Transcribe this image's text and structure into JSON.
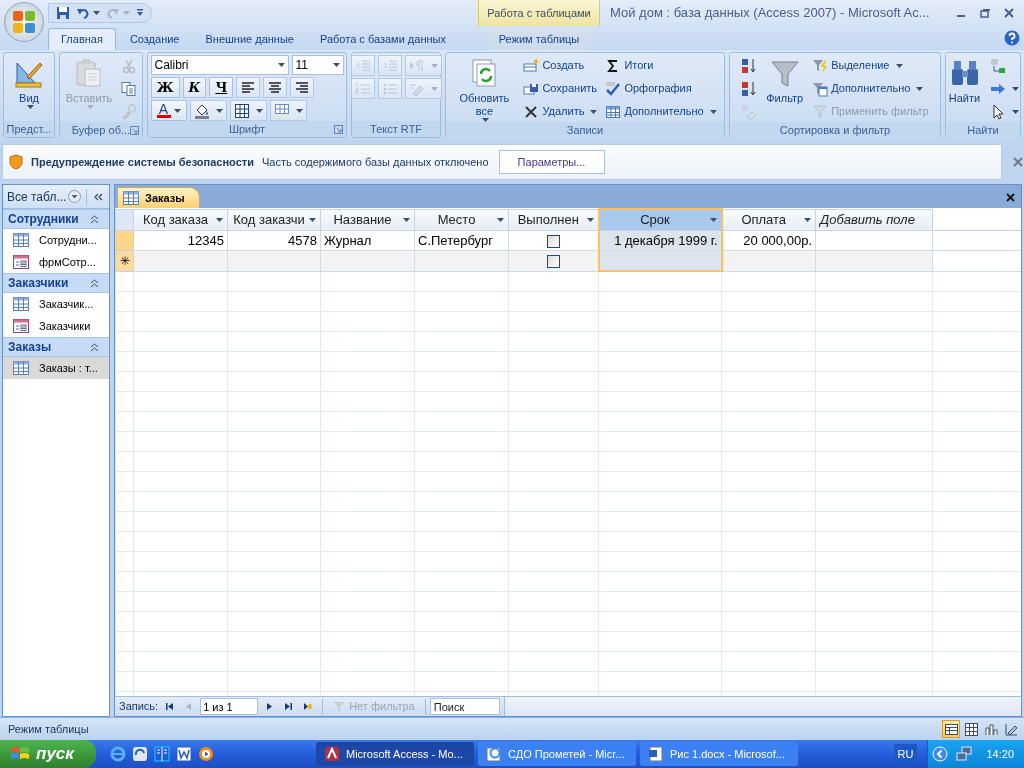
{
  "window": {
    "title": "Мой дом : база данных (Access 2007) - Microsoft Ac...",
    "contextual_tab": "Работа с таблицами"
  },
  "quick_access": [
    {
      "kind": "save",
      "disabled": false
    },
    {
      "kind": "undo",
      "disabled": false,
      "dropdown": true
    },
    {
      "kind": "redo",
      "disabled": true,
      "dropdown": true
    },
    {
      "kind": "customize",
      "disabled": false
    }
  ],
  "ribbon_tabs": [
    {
      "label": "Главная",
      "selected": true,
      "contextual": false
    },
    {
      "label": "Создание",
      "selected": false,
      "contextual": false
    },
    {
      "label": "Внешние данные",
      "selected": false,
      "contextual": false
    },
    {
      "label": "Работа с базами данных",
      "selected": false,
      "contextual": false
    },
    {
      "label": "Режим таблицы",
      "selected": false,
      "contextual": true
    }
  ],
  "ribbon_groups": [
    {
      "title": "Предст...",
      "launcher": false,
      "columns": [
        [
          [
            {
              "kind": "large",
              "label": "Вид",
              "dropdown": true,
              "disabled": false
            }
          ]
        ]
      ]
    },
    {
      "title": "Буфер об...",
      "launcher": true,
      "columns": [
        [
          [
            {
              "kind": "large",
              "label": "Вставить",
              "dropdown": true,
              "disabled": true
            }
          ]
        ],
        [
          [
            {
              "kind": "icon",
              "disabled": true
            }
          ],
          [
            {
              "kind": "icon",
              "disabled": false
            }
          ],
          [
            {
              "kind": "icon",
              "disabled": true
            }
          ]
        ]
      ]
    },
    {
      "title": "Шрифт",
      "launcher": true,
      "columns": [
        [
          [
            {
              "kind": "combo",
              "value": "Calibri",
              "disabled": false
            },
            {
              "kind": "combo",
              "value": "11",
              "disabled": false
            }
          ],
          [
            {
              "kind": "glyph",
              "label": "Ж",
              "disabled": false
            },
            {
              "kind": "glyph",
              "label": "К",
              "disabled": false
            },
            {
              "kind": "glyph",
              "label": "Ч",
              "disabled": false
            },
            {
              "kind": "icon",
              "disabled": false
            },
            {
              "kind": "icon",
              "disabled": false
            },
            {
              "kind": "icon",
              "disabled": false
            }
          ],
          [
            {
              "kind": "glyph",
              "label": "A",
              "dropdown": true,
              "disabled": false
            },
            {
              "kind": "icon",
              "dropdown": true,
              "disabled": false
            },
            {
              "kind": "icon",
              "dropdown": true,
              "disabled": false
            },
            {
              "kind": "icon",
              "dropdown": true,
              "disabled": false
            }
          ]
        ]
      ]
    },
    {
      "title": "Текст RTF",
      "launcher": false,
      "columns": [
        [
          [
            {
              "kind": "icon",
              "disabled": true
            },
            {
              "kind": "icon",
              "disabled": true
            },
            {
              "kind": "icon",
              "dropdown": true,
              "disabled": true
            }
          ],
          [
            {
              "kind": "icon",
              "disabled": true
            },
            {
              "kind": "icon",
              "disabled": true
            },
            {
              "kind": "icon",
              "dropdown": true,
              "disabled": true
            }
          ]
        ]
      ]
    },
    {
      "title": "Записи",
      "launcher": false,
      "columns": [
        [
          [
            {
              "kind": "large",
              "label": "Обновить все",
              "dropdown": true,
              "disabled": false
            }
          ]
        ],
        [
          [
            {
              "kind": "small",
              "label": "Создать",
              "disabled": false
            }
          ],
          [
            {
              "kind": "small",
              "label": "Сохранить",
              "disabled": false
            }
          ],
          [
            {
              "kind": "small",
              "label": "Удалить",
              "dropdown": true,
              "disabled": false
            }
          ]
        ],
        [
          [
            {
              "kind": "small",
              "label": "Итоги",
              "disabled": false
            }
          ],
          [
            {
              "kind": "small",
              "label": "Орфография",
              "disabled": false
            }
          ],
          [
            {
              "kind": "small",
              "label": "Дополнительно",
              "dropdown": true,
              "disabled": false
            }
          ]
        ]
      ]
    },
    {
      "title": "Сортировка и фильтр",
      "launcher": false,
      "columns": [
        [
          [
            {
              "kind": "icon",
              "disabled": false
            }
          ],
          [
            {
              "kind": "icon",
              "disabled": false
            }
          ],
          [
            {
              "kind": "icon",
              "disabled": true
            }
          ]
        ],
        [
          [
            {
              "kind": "large",
              "label": "Фильтр",
              "disabled": false
            }
          ]
        ],
        [
          [
            {
              "kind": "small",
              "label": "Выделение",
              "dropdown": true,
              "disabled": false
            }
          ],
          [
            {
              "kind": "small",
              "label": "Дополнительно",
              "dropdown": true,
              "disabled": false
            }
          ],
          [
            {
              "kind": "small",
              "label": "Применить фильтр",
              "disabled": true
            }
          ]
        ]
      ]
    },
    {
      "title": "Найти",
      "launcher": false,
      "columns": [
        [
          [
            {
              "kind": "large",
              "label": "Найти",
              "disabled": false
            }
          ]
        ],
        [
          [
            {
              "kind": "icon",
              "disabled": false
            }
          ],
          [
            {
              "kind": "icon",
              "dropdown": true,
              "disabled": false
            }
          ],
          [
            {
              "kind": "icon",
              "dropdown": true,
              "disabled": false
            }
          ]
        ]
      ]
    }
  ],
  "security_bar": {
    "title": "Предупреждение системы безопасности",
    "message": "Часть содержимого базы данных отключено",
    "button": "Параметры..."
  },
  "navigation": {
    "header": "Все табл...",
    "groups": [
      {
        "name": "Сотрудники",
        "expanded": true,
        "items": [
          {
            "kind": "table",
            "label": "Сотрудни...",
            "selected": false
          },
          {
            "kind": "form",
            "label": "фрмСотр...",
            "selected": false
          }
        ]
      },
      {
        "name": "Заказчики",
        "expanded": true,
        "items": [
          {
            "kind": "table",
            "label": "Заказчик...",
            "selected": false
          },
          {
            "kind": "form",
            "label": "Заказчики",
            "selected": false
          }
        ]
      },
      {
        "name": "Заказы",
        "expanded": true,
        "items": [
          {
            "kind": "table",
            "label": "Заказы : т...",
            "selected": true
          }
        ]
      }
    ]
  },
  "document_tab": {
    "label": "Заказы"
  },
  "table": {
    "columns": [
      {
        "label": "Код заказа",
        "kind": "number",
        "selected": false
      },
      {
        "label": "Код заказчи",
        "kind": "number",
        "selected": false
      },
      {
        "label": "Название",
        "kind": "text",
        "selected": false
      },
      {
        "label": "Место",
        "kind": "text",
        "selected": false
      },
      {
        "label": "Выполнен",
        "kind": "check",
        "selected": false
      },
      {
        "label": "Срок",
        "kind": "date",
        "selected": true
      },
      {
        "label": "Оплата",
        "kind": "money",
        "selected": false
      },
      {
        "label": "Добавить поле",
        "kind": "add",
        "selected": false
      }
    ],
    "rows": [
      {
        "kind": "current",
        "cells": [
          "12345",
          "4578",
          "Журнал",
          "С.Петербург",
          {
            "checked": false
          },
          "1 декабря 1999 г.",
          "20 000,00р.",
          null
        ]
      },
      {
        "kind": "new",
        "marker": "✳",
        "cells": [
          null,
          null,
          null,
          null,
          {
            "checked": false
          },
          null,
          null,
          null
        ]
      }
    ]
  },
  "record_nav": {
    "label": "Запись:",
    "position": "1 из 1",
    "filter": "Нет фильтра",
    "filter_disabled": true,
    "search_placeholder": "Поиск"
  },
  "status_bar": {
    "text": "Режим таблицы",
    "views": [
      {
        "selected": true
      },
      {
        "selected": false
      },
      {
        "selected": false
      },
      {
        "selected": false
      }
    ]
  },
  "taskbar": {
    "start": "пуск",
    "tasks": [
      {
        "kind": "access",
        "label": "Microsoft Access - Mo...",
        "selected": true
      },
      {
        "kind": "browser",
        "label": "СДО Прометей - Micr...",
        "selected": false
      },
      {
        "kind": "word",
        "label": "Рис 1.docx - Microsof...",
        "selected": false
      }
    ],
    "language": "RU",
    "clock": "14:20"
  }
}
